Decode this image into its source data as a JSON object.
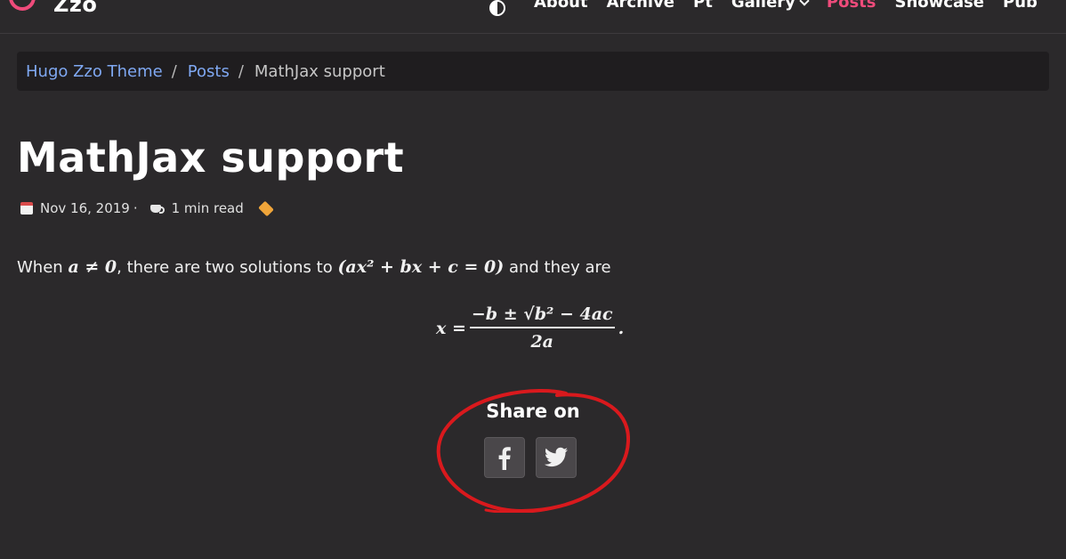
{
  "nav": {
    "brand": "Zzo",
    "items": [
      {
        "label": "About",
        "active": false
      },
      {
        "label": "Archive",
        "active": false
      },
      {
        "label": "Pt",
        "active": false
      },
      {
        "label": "Gallery",
        "active": false,
        "dropdown": true
      },
      {
        "label": "Posts",
        "active": true
      },
      {
        "label": "Showcase",
        "active": false
      },
      {
        "label": "Pub",
        "active": false
      }
    ],
    "accent_color": "#ef4b7b",
    "theme_toggle_icon": "half-circle-icon"
  },
  "breadcrumb": {
    "items": [
      "Hugo Zzo Theme",
      "Posts"
    ],
    "separator": "/",
    "current": "MathJax support"
  },
  "post": {
    "title": "MathJax support",
    "date": "Nov 16, 2019",
    "meta_separator": "·",
    "read_time": "1 min read",
    "icons": [
      "calendar-icon",
      "coffee-icon",
      "tag-icon"
    ]
  },
  "content": {
    "text_when": "When",
    "math_inline_1": "a ≠ 0",
    "text_there_are": ", there are two solutions to",
    "math_inline_2": "(ax² + bx + c = 0)",
    "text_and_they_are": "and they are",
    "equation_lhs": "x =",
    "equation_numerator": "−b ± √b² − 4ac",
    "equation_denominator": "2a",
    "equation_end": "."
  },
  "share": {
    "title": "Share on",
    "buttons": [
      {
        "name": "facebook",
        "icon": "facebook-icon"
      },
      {
        "name": "twitter",
        "icon": "twitter-icon"
      }
    ],
    "annotation_color": "#d9191d"
  }
}
